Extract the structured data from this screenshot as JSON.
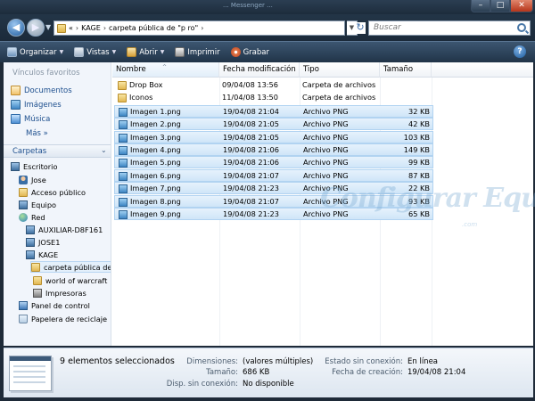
{
  "taskbar": {
    "ghost_text": "... Messenger ..."
  },
  "window": {
    "minimize": "–",
    "maximize": "□",
    "close": "✕"
  },
  "address_bar": {
    "chevrons": "«",
    "crumbs": [
      "KAGE",
      "carpeta pública de \"p                    ro\""
    ],
    "separator": "›",
    "refresh": "↻"
  },
  "search": {
    "placeholder": "Buscar"
  },
  "toolbar": {
    "organize": "Organizar",
    "views": "Vistas",
    "open": "Abrir",
    "print": "Imprimir",
    "burn": "Grabar",
    "help": "?"
  },
  "nav_pane": {
    "favorites_title": "Vínculos favoritos",
    "favorites": [
      {
        "label": "Documentos",
        "icon": "documents-icon"
      },
      {
        "label": "Imágenes",
        "icon": "pictures-icon"
      },
      {
        "label": "Música",
        "icon": "music-icon"
      }
    ],
    "more": "Más »",
    "folders_title": "Carpetas",
    "tree": [
      {
        "label": "Escritorio",
        "icon": "desktop-icon"
      },
      {
        "label": "Jose",
        "icon": "user-icon"
      },
      {
        "label": "Acceso público",
        "icon": "folder-icon"
      },
      {
        "label": "Equipo",
        "icon": "computer-icon"
      },
      {
        "label": "Red",
        "icon": "network-icon"
      },
      {
        "label": "AUXILIAR-D8F161",
        "icon": "computer-icon"
      },
      {
        "label": "JOSE1",
        "icon": "computer-icon"
      },
      {
        "label": "KAGE",
        "icon": "computer-icon"
      },
      {
        "label": "carpeta pública de",
        "icon": "folder-icon"
      },
      {
        "label": "world of warcraft",
        "icon": "folder-icon"
      },
      {
        "label": "Impresoras",
        "icon": "printer-icon"
      },
      {
        "label": "Panel de control",
        "icon": "control-panel-icon"
      },
      {
        "label": "Papelera de reciclaje",
        "icon": "recycle-bin-icon"
      }
    ]
  },
  "columns": {
    "name": "Nombre",
    "date": "Fecha modificación",
    "type": "Tipo",
    "size": "Tamaño",
    "sort_indicator": "^"
  },
  "files": [
    {
      "name": "Drop Box",
      "date": "09/04/08 13:56",
      "type": "Carpeta de archivos",
      "size": "",
      "kind": "folder",
      "selected": false
    },
    {
      "name": "Iconos",
      "date": "11/04/08 13:50",
      "type": "Carpeta de archivos",
      "size": "",
      "kind": "folder",
      "selected": false
    },
    {
      "name": "Imagen 1.png",
      "date": "19/04/08 21:04",
      "type": "Archivo PNG",
      "size": "32 KB",
      "kind": "image",
      "selected": true
    },
    {
      "name": "Imagen 2.png",
      "date": "19/04/08 21:05",
      "type": "Archivo PNG",
      "size": "42 KB",
      "kind": "image",
      "selected": true
    },
    {
      "name": "Imagen 3.png",
      "date": "19/04/08 21:05",
      "type": "Archivo PNG",
      "size": "103 KB",
      "kind": "image",
      "selected": true
    },
    {
      "name": "Imagen 4.png",
      "date": "19/04/08 21:06",
      "type": "Archivo PNG",
      "size": "149 KB",
      "kind": "image",
      "selected": true
    },
    {
      "name": "Imagen 5.png",
      "date": "19/04/08 21:06",
      "type": "Archivo PNG",
      "size": "99 KB",
      "kind": "image",
      "selected": true
    },
    {
      "name": "Imagen 6.png",
      "date": "19/04/08 21:07",
      "type": "Archivo PNG",
      "size": "87 KB",
      "kind": "image",
      "selected": true
    },
    {
      "name": "Imagen 7.png",
      "date": "19/04/08 21:23",
      "type": "Archivo PNG",
      "size": "22 KB",
      "kind": "image",
      "selected": true
    },
    {
      "name": "Imagen 8.png",
      "date": "19/04/08 21:07",
      "type": "Archivo PNG",
      "size": "93 KB",
      "kind": "image",
      "selected": true
    },
    {
      "name": "Imagen 9.png",
      "date": "19/04/08 21:23",
      "type": "Archivo PNG",
      "size": "65 KB",
      "kind": "image",
      "selected": true
    }
  ],
  "watermark": {
    "text": "Configurar Equipos",
    "sub": ".com"
  },
  "details": {
    "count": "9 elementos seleccionados",
    "dimensions_label": "Dimensiones:",
    "dimensions_value": "(valores múltiples)",
    "size_label": "Tamaño:",
    "size_value": "686 KB",
    "offline_avail_label": "Disp. sin conexión:",
    "offline_avail_value": "No disponible",
    "offline_state_label": "Estado sin conexión:",
    "offline_state_value": "En línea",
    "created_label": "Fecha de creación:",
    "created_value": "19/04/08 21:04"
  },
  "colors": {
    "selection": "#cfe5f8",
    "link": "#1d4f8e",
    "chrome": "#213448"
  }
}
